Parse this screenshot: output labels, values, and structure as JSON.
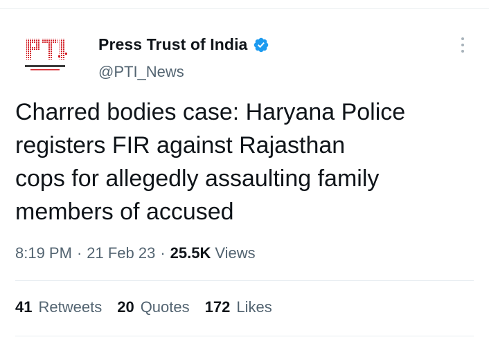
{
  "author": {
    "display_name": "Press Trust of India",
    "handle": "@PTI_News",
    "verified": true,
    "avatar_logo_text": "PTI",
    "avatar_caption": "PRESS TRUST OF INDIA",
    "avatar_color": "#d32027",
    "verified_color": "#1d9bf0"
  },
  "tweet": {
    "text_lines": [
      "Charred bodies case: Haryana Police",
      "registers FIR against Rajasthan",
      "cops for allegedly assaulting family",
      "members of accused"
    ],
    "time": "8:19 PM",
    "date": "21 Feb 23",
    "separator": "·",
    "views_count": "25.5K",
    "views_label": "Views"
  },
  "stats": [
    {
      "count": "41",
      "label": "Retweets"
    },
    {
      "count": "20",
      "label": "Quotes"
    },
    {
      "count": "172",
      "label": "Likes"
    }
  ],
  "icons": {
    "more": "more-vertical-icon",
    "verified": "verified-badge-icon"
  }
}
